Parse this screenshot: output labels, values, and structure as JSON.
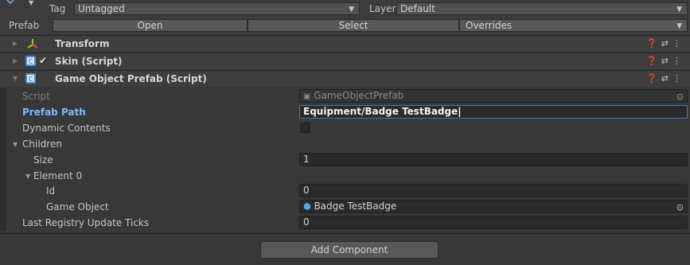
{
  "header": {
    "tag_label": "Tag",
    "tag_value": "Untagged",
    "layer_label": "Layer",
    "layer_value": "Default",
    "prefab_label": "Prefab",
    "open_label": "Open",
    "select_label": "Select",
    "overrides_label": "Overrides"
  },
  "components": {
    "transform": {
      "title": "Transform"
    },
    "skin": {
      "title": "Skin (Script)",
      "enabled": true
    },
    "gop": {
      "title": "Game Object Prefab (Script)"
    }
  },
  "icons": {
    "help": "help-icon",
    "presets": "presets-icon",
    "menu": "kebab-menu-icon"
  },
  "properties": {
    "script": {
      "label": "Script",
      "value": "GameObjectPrefab"
    },
    "prefab_path": {
      "label": "Prefab Path",
      "value": "Equipment/Badge TestBadge"
    },
    "dynamic_contents": {
      "label": "Dynamic Contents",
      "checked": false
    },
    "children": {
      "label": "Children"
    },
    "size": {
      "label": "Size",
      "value": "1"
    },
    "element0": {
      "label": "Element 0"
    },
    "id": {
      "label": "Id",
      "value": "0"
    },
    "game_object": {
      "label": "Game Object",
      "value": "Badge TestBadge"
    },
    "last_registry": {
      "label": "Last Registry Update Ticks",
      "value": "0"
    }
  },
  "footer": {
    "add_component_label": "Add Component"
  },
  "colors": {
    "accent": "#7cb8ff",
    "field_focus_border": "#3a79bb",
    "background": "#383838"
  }
}
